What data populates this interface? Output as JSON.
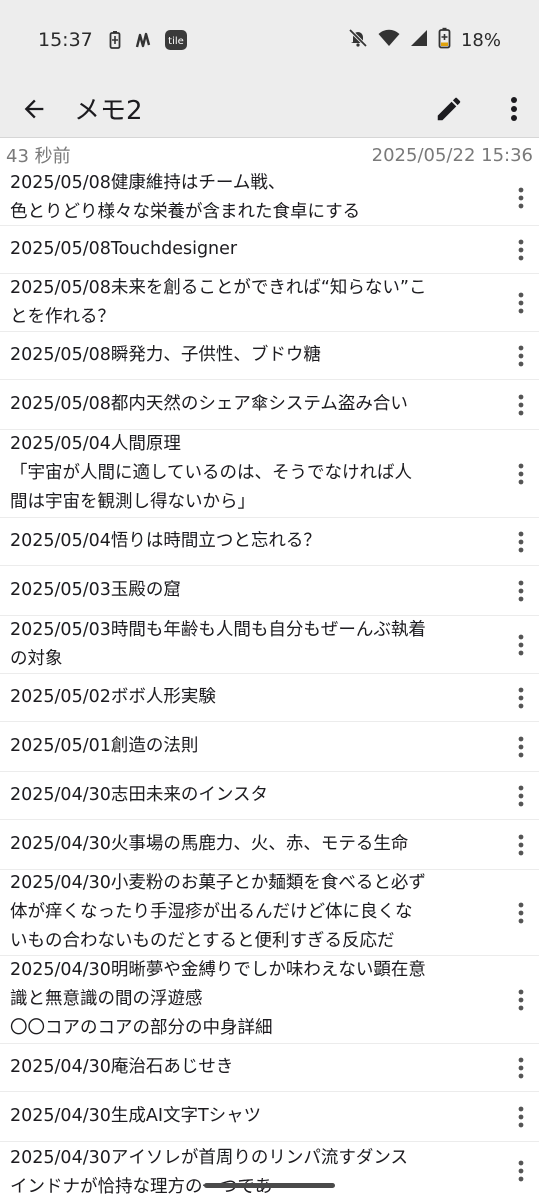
{
  "status_bar": {
    "time": "15:37",
    "tile_label": "tile",
    "battery_percent": "18%",
    "icons": [
      "battery-saver-icon",
      "notification-icon",
      "tile-app-icon",
      "mute-icon",
      "wifi-icon",
      "signal-icon",
      "battery-icon"
    ]
  },
  "app_bar": {
    "title": "メモ2",
    "back_icon": "arrow-back-icon",
    "edit_icon": "pencil-icon",
    "menu_icon": "more-vert-icon"
  },
  "meta": {
    "relative_time": "43 秒前",
    "datetime": "2025/05/22 15:36"
  },
  "memo_items": [
    {
      "text": "2025/05/08健康維持はチーム戦、\n色とりどり様々な栄養が含まれた食卓にする"
    },
    {
      "text": "2025/05/08Touchdesigner"
    },
    {
      "text": "2025/05/08未来を創ることができれば“知らない”こ\nとを作れる？"
    },
    {
      "text": "2025/05/08瞬発力、子供性、ブドウ糖"
    },
    {
      "text": "2025/05/08都内天然のシェア傘システム盗み合い"
    },
    {
      "text": "2025/05/04人間原理\n「宇宙が人間に適しているのは、そうでなければ人\n間は宇宙を観測し得ないから」"
    },
    {
      "text": "2025/05/04悟りは時間立つと忘れる？"
    },
    {
      "text": "2025/05/03玉殿の窟"
    },
    {
      "text": "2025/05/03時間も年齢も人間も自分もぜーんぶ執着\nの対象"
    },
    {
      "text": "2025/05/02ボボ人形実験"
    },
    {
      "text": "2025/05/01創造の法則"
    },
    {
      "text": "2025/04/30志田未来のインスタ"
    },
    {
      "text": "2025/04/30火事場の馬鹿力、火、赤、モテる生命"
    },
    {
      "text": "2025/04/30小麦粉のお菓子とか麺類を食べると必ず\n体が痒くなったり手湿疹が出るんだけど体に良くな\nいもの合わないものだとすると便利すぎる反応だ"
    },
    {
      "text": "2025/04/30明晰夢や金縛りでしか味わえない顕在意\n識と無意識の間の浮遊感\n〇〇コアのコアの部分の中身詳細"
    },
    {
      "text": "2025/04/30庵治石あじせき"
    },
    {
      "text": "2025/04/30生成AI文字Tシャツ"
    },
    {
      "text": "2025/04/30アイソレが首周りのリンパ流すダンス\nインドナが恰持な理方の一つであ"
    }
  ],
  "colors": {
    "bar_background": "#ededed",
    "text_primary": "#1c1b1f",
    "text_secondary": "#7a7a7a",
    "divider": "#ececec"
  }
}
